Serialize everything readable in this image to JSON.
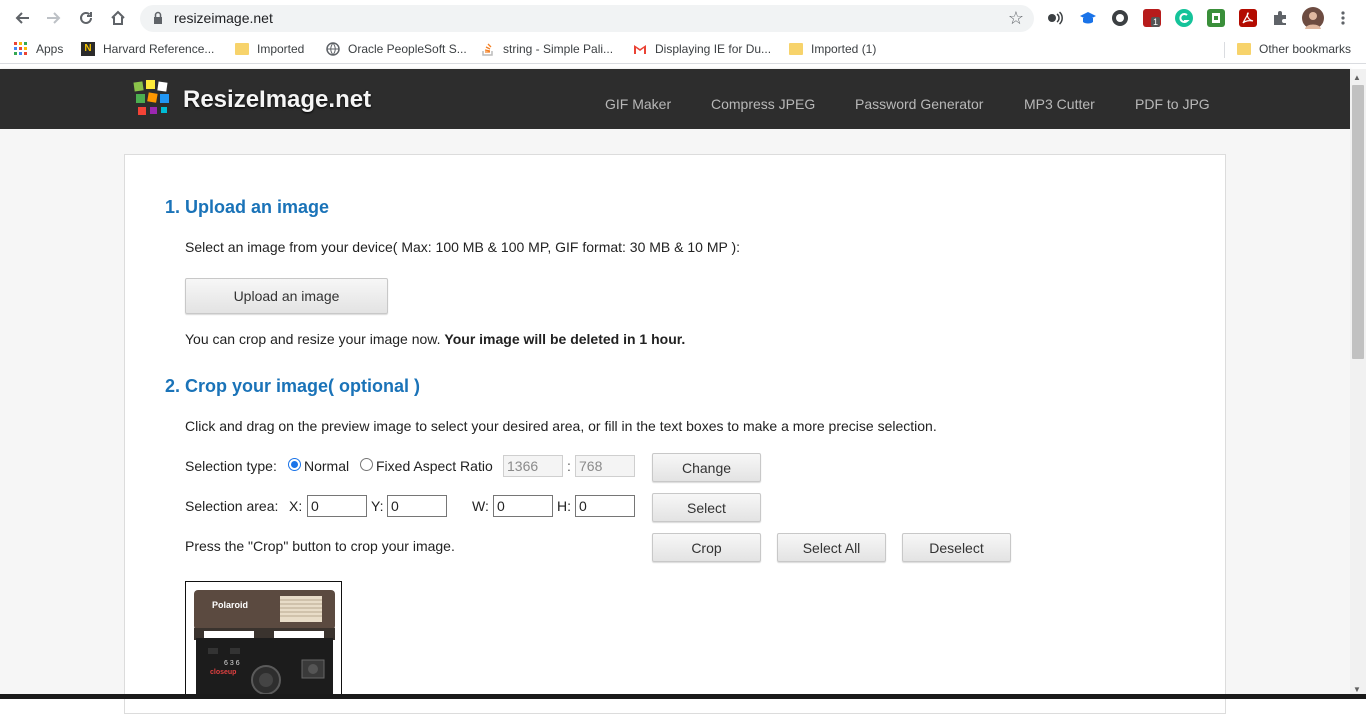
{
  "browser": {
    "url": "resizeimage.net",
    "bookmarks": [
      {
        "label": "Apps"
      },
      {
        "label": "Harvard Reference..."
      },
      {
        "label": "Imported"
      },
      {
        "label": "Oracle PeopleSoft S..."
      },
      {
        "label": "string - Simple Pali..."
      },
      {
        "label": "Displaying IE for Du..."
      },
      {
        "label": "Imported (1)"
      }
    ],
    "other_bookmarks": "Other bookmarks",
    "extension_badge": "1"
  },
  "site": {
    "brand": "ResizeImage.net",
    "nav": [
      "GIF Maker",
      "Compress JPEG",
      "Password Generator",
      "MP3 Cutter",
      "PDF to JPG"
    ]
  },
  "section1": {
    "title": "1. Upload an image",
    "instruction": "Select an image from your device( Max: 100 MB & 100 MP, GIF format: 30 MB & 10 MP ):",
    "upload_button": "Upload an image",
    "note": "You can crop and resize your image now.",
    "note_bold": "Your image will be deleted in 1 hour."
  },
  "section2": {
    "title": "2. Crop your image( optional )",
    "instruction": "Click and drag on the preview image to select your desired area, or fill in the text boxes to make a more precise selection.",
    "selection_type_label": "Selection type:",
    "normal_label": "Normal",
    "fixed_label": "Fixed Aspect Ratio",
    "ratio_w": "1366",
    "ratio_sep": ":",
    "ratio_h": "768",
    "change_button": "Change",
    "area_label": "Selection area:",
    "x_label": "X:",
    "x_value": "0",
    "y_label": "Y:",
    "y_value": "0",
    "w_label": "W:",
    "w_value": "0",
    "h_label": "H:",
    "h_value": "0",
    "select_button": "Select",
    "crop_hint": "Press the \"Crop\" button to crop your image.",
    "crop_button": "Crop",
    "select_all_button": "Select All",
    "deselect_button": "Deselect"
  },
  "preview": {
    "brand_text": "Polaroid",
    "model_text": "636",
    "model_sub": "closeup"
  }
}
